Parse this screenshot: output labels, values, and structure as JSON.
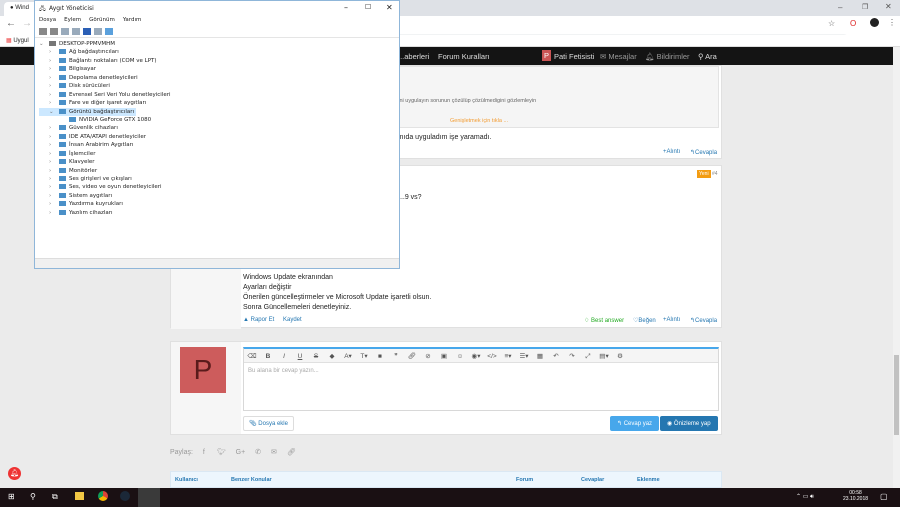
{
  "browser": {
    "tab_title": "Wind",
    "bookmark": "Uygul"
  },
  "nav": {
    "items": [
      "...aberleri",
      "Forum Kuralları"
    ],
    "user": "Pati Fetisisti",
    "user_initial": "P",
    "messages": "Mesajlar",
    "alerts": "Bildirimler",
    "search": "Ara"
  },
  "post3": {
    "quote_text": "...im önerilerini uygulayın sorunun çözülüp çözülmedigini gözlemleyin",
    "expand": "Genişletmek için tıkla ...",
    "body": "...dımıda uyguladım işe yaramadı.",
    "quote_btn": "Alıntı",
    "reply_btn": "Cevapla"
  },
  "post4": {
    "badge": "Yeni",
    "number": "#4",
    "question": "...9 vs?",
    "lines": [
      "Windows Update ekranından",
      "Ayarları değiştir",
      "Önerilen güncelleştirmeler ve Microsoft Update işaretli olsun.",
      "Sonra Güncellemeleri denetleyiniz."
    ],
    "report": "Rapor Et",
    "save": "Kaydet",
    "best": "Best answer",
    "like": "Beğen",
    "quote_btn": "Alıntı",
    "reply_btn": "Cevapla"
  },
  "reply": {
    "avatar_initial": "P",
    "placeholder": "Bu alana bir cevap yazın...",
    "attach": "Dosya ekle",
    "submit": "Cevap yaz",
    "preview": "Önizleme yap"
  },
  "share": {
    "label": "Paylaş:"
  },
  "similar": {
    "headers": [
      "Kullanıcı",
      "Benzer Konular",
      "Forum",
      "Cevaplar",
      "Eklenme"
    ]
  },
  "device_manager": {
    "title": "Aygıt Yöneticisi",
    "menu": [
      "Dosya",
      "Eylem",
      "Görünüm",
      "Yardım"
    ],
    "root": "DESKTOP-PPMVMHM",
    "items": [
      "Ağ bağdaştırıcıları",
      "Bağlantı noktaları (COM ve LPT)",
      "Bilgisayar",
      "Depolama denetleyicileri",
      "Disk sürücüleri",
      "Evrensel Seri Veri Yolu denetleyicileri",
      "Fare ve diğer işaret aygıtları",
      "Görüntü bağdaştırıcıları",
      "NVIDIA GeForce GTX 1080",
      "Güvenlik cihazları",
      "IDE ATA/ATAPI denetleyiciler",
      "İnsan Arabirim Aygıtları",
      "İşlemciler",
      "Klavyeler",
      "Monitörler",
      "Ses girişleri ve çıkışları",
      "Ses, video ve oyun denetleyicileri",
      "Sistem aygıtları",
      "Yazdırma kuyrukları",
      "Yazılım cihazları"
    ],
    "expanded": "Görüntü bağdaştırıcıları"
  },
  "taskbar": {
    "time": "00:58",
    "date": "23.10.2018"
  }
}
